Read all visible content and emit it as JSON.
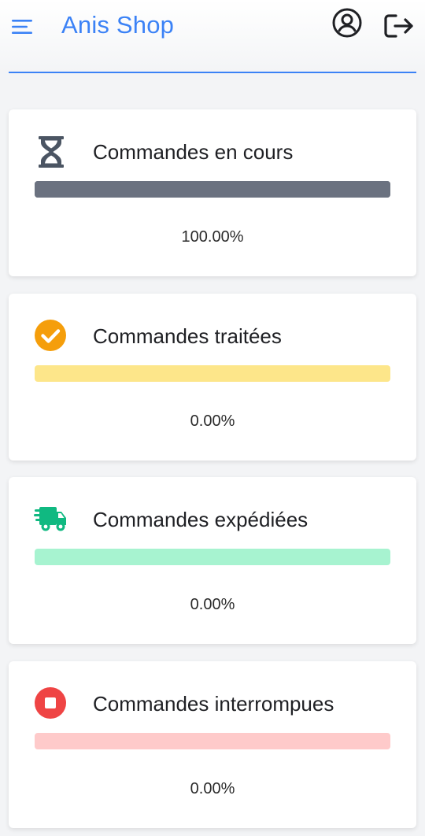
{
  "header": {
    "title": "Anis Shop",
    "menu_icon": "hamburger-menu-icon",
    "account_icon": "user-circle-icon",
    "logout_icon": "logout-icon",
    "accent_color": "#3b82f6"
  },
  "cards": [
    {
      "title": "Commandes en cours",
      "percent_label": "100.00%",
      "progress": 1.0,
      "icon": "hourglass-icon",
      "track_color": "#6b7280",
      "fill_color": "#6b7280"
    },
    {
      "title": "Commandes traitées",
      "percent_label": "0.00%",
      "progress": 0.0,
      "icon": "check-circle-icon",
      "track_color": "#fde68a",
      "fill_color": "#f59e0b"
    },
    {
      "title": "Commandes expédiées",
      "percent_label": "0.00%",
      "progress": 0.0,
      "icon": "truck-icon",
      "track_color": "#a7f3d0",
      "fill_color": "#10b981"
    },
    {
      "title": "Commandes interrompues",
      "percent_label": "0.00%",
      "progress": 0.0,
      "icon": "stop-circle-icon",
      "track_color": "#fecaca",
      "fill_color": "#ef4444"
    }
  ]
}
